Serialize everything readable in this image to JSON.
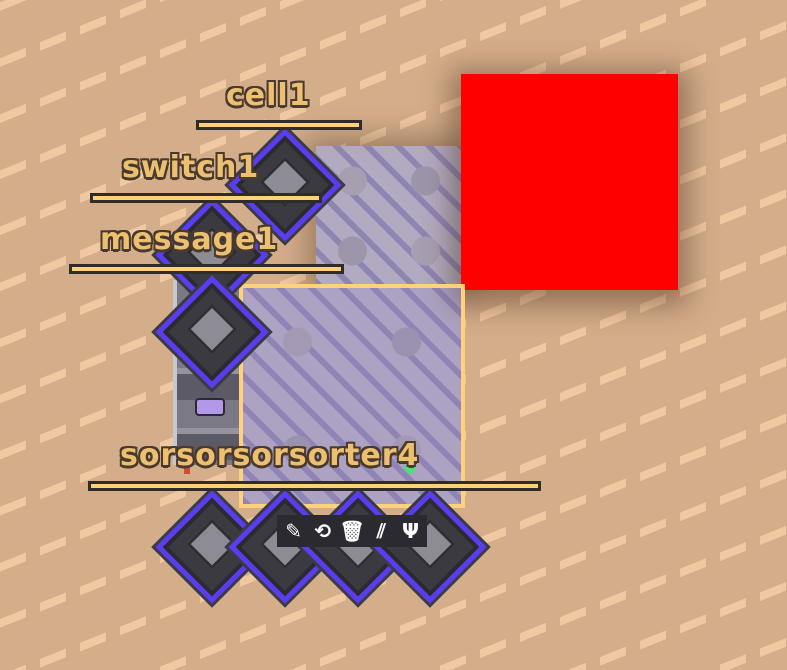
{
  "labels": {
    "cell": "cell1",
    "switch": "switch1",
    "message": "message1",
    "sorter": "sorsorsorsorter4"
  },
  "toolbar": {
    "edit_icon": "pencil-icon",
    "rotate_icon": "rotate-icon",
    "delete_icon": "trash-icon",
    "disable_icon": "disable-links-icon",
    "link_icon": "trident-link-icon"
  },
  "colors": {
    "selection": "#ffd17a",
    "highlight_block": "#ff0000",
    "diamond_border": "#5a3df0",
    "label_text": "#ecc070"
  }
}
